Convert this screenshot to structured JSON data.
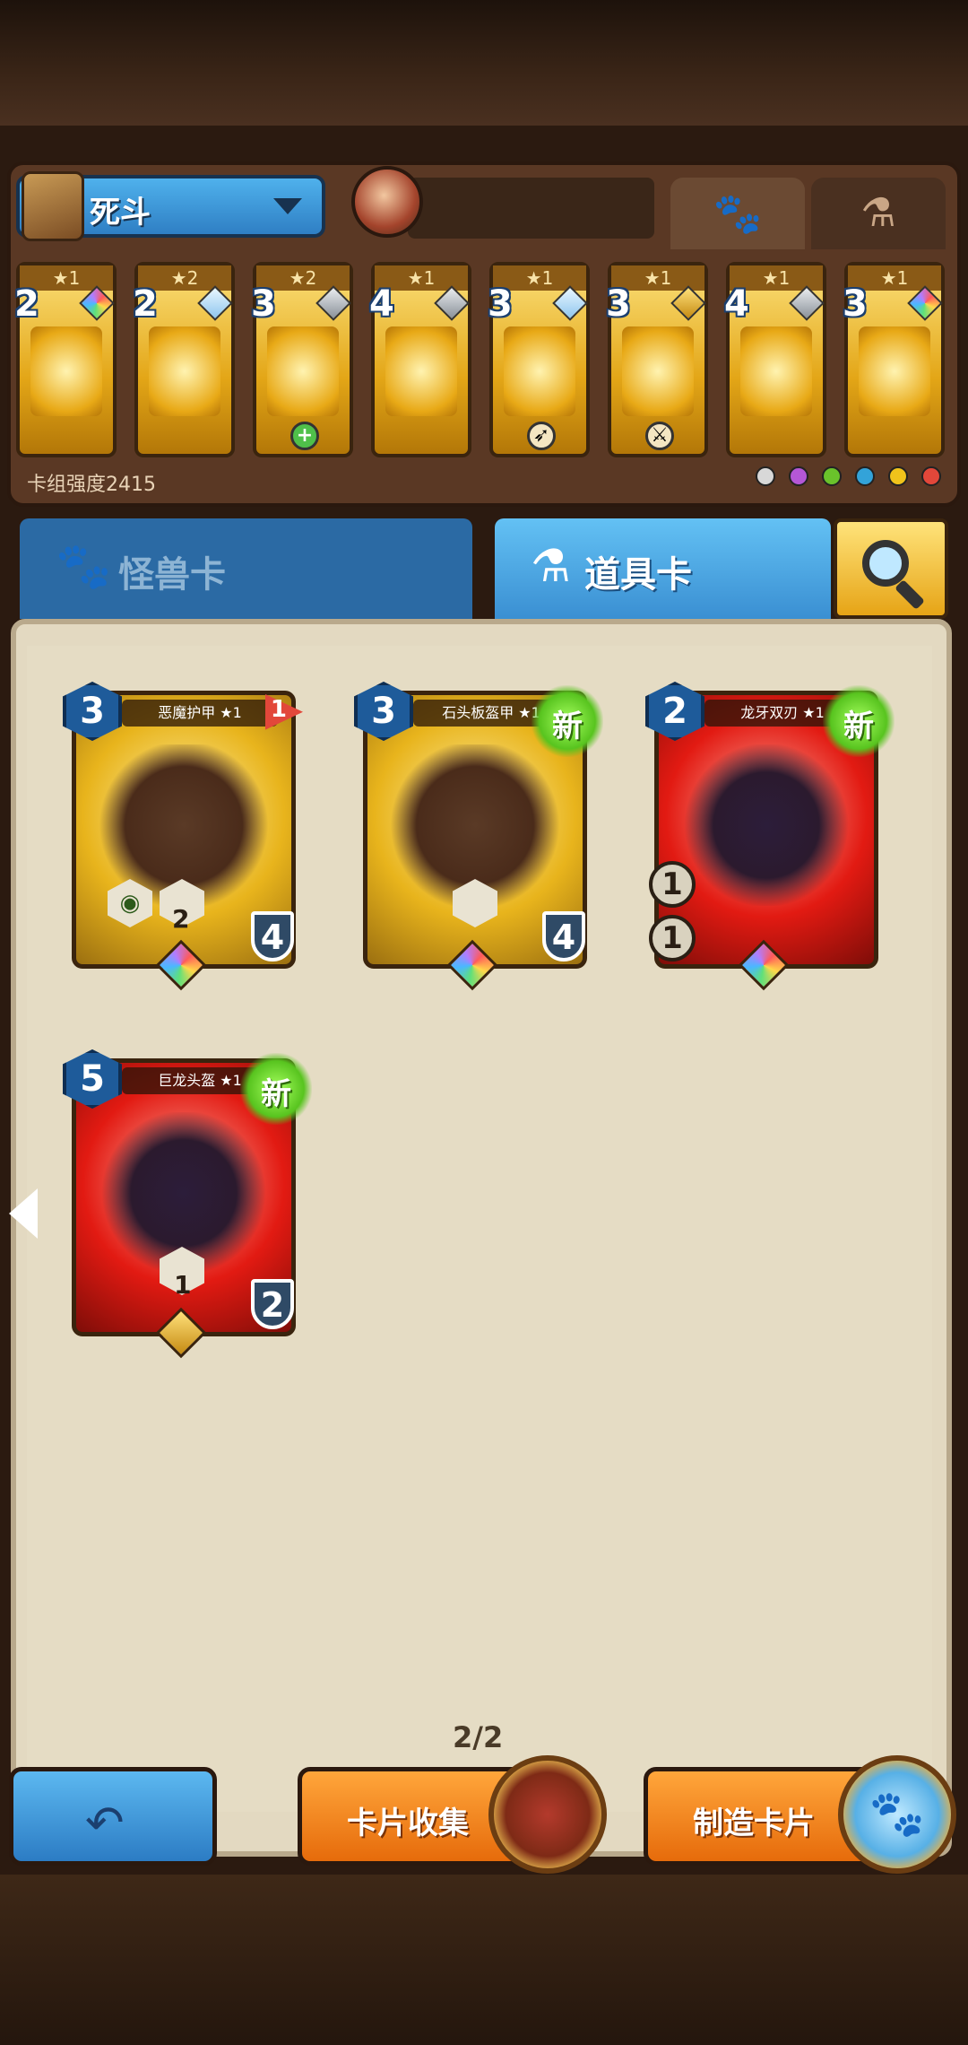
{
  "header": {
    "deck_name": "死斗",
    "tabs": [
      {
        "icon": "paw-icon",
        "glyph": "🐾"
      },
      {
        "icon": "potion-icon",
        "glyph": "⚗"
      }
    ]
  },
  "deck": {
    "cards": [
      {
        "stars": "★1",
        "cost": "2",
        "gem": "rainbow"
      },
      {
        "stars": "★2",
        "cost": "2",
        "gem": "ice"
      },
      {
        "stars": "★2",
        "cost": "3",
        "gem": "silver",
        "extra": "+"
      },
      {
        "stars": "★1",
        "cost": "4",
        "gem": "silver"
      },
      {
        "stars": "★1",
        "cost": "3",
        "gem": "ice"
      },
      {
        "stars": "★1",
        "cost": "3",
        "gem": "gold"
      },
      {
        "stars": "★1",
        "cost": "4",
        "gem": "silver"
      },
      {
        "stars": "★1",
        "cost": "3",
        "gem": "rainbow"
      }
    ],
    "power_label": "卡组强度2415",
    "elements": [
      "#d8d8d8",
      "#b457d6",
      "#6ac22b",
      "#33a3d9",
      "#f0c31b",
      "#e2473a"
    ]
  },
  "tabs": {
    "monster_label": "怪兽卡",
    "item_label": "道具卡"
  },
  "collection": {
    "cards": [
      {
        "name": "恶魔护甲 ★1",
        "cost": "3",
        "armor": "4",
        "color": "gold",
        "gem": "rainbow",
        "flag": "1",
        "hex_value": "2"
      },
      {
        "name": "石头板盔甲 ★1",
        "cost": "3",
        "armor": "4",
        "color": "gold",
        "gem": "rainbow",
        "new": "新"
      },
      {
        "name": "龙牙双刃 ★1",
        "cost": "2",
        "color": "red",
        "gem": "rainbow",
        "new": "新",
        "stat1": "1",
        "stat2": "1"
      },
      {
        "name": "巨龙头盔 ★1",
        "cost": "5",
        "armor": "2",
        "color": "red",
        "gem": "gold",
        "new": "新",
        "hex_value": "1"
      }
    ],
    "page": "2/2"
  },
  "footer": {
    "collect_label": "卡片收集",
    "craft_label": "制造卡片"
  }
}
